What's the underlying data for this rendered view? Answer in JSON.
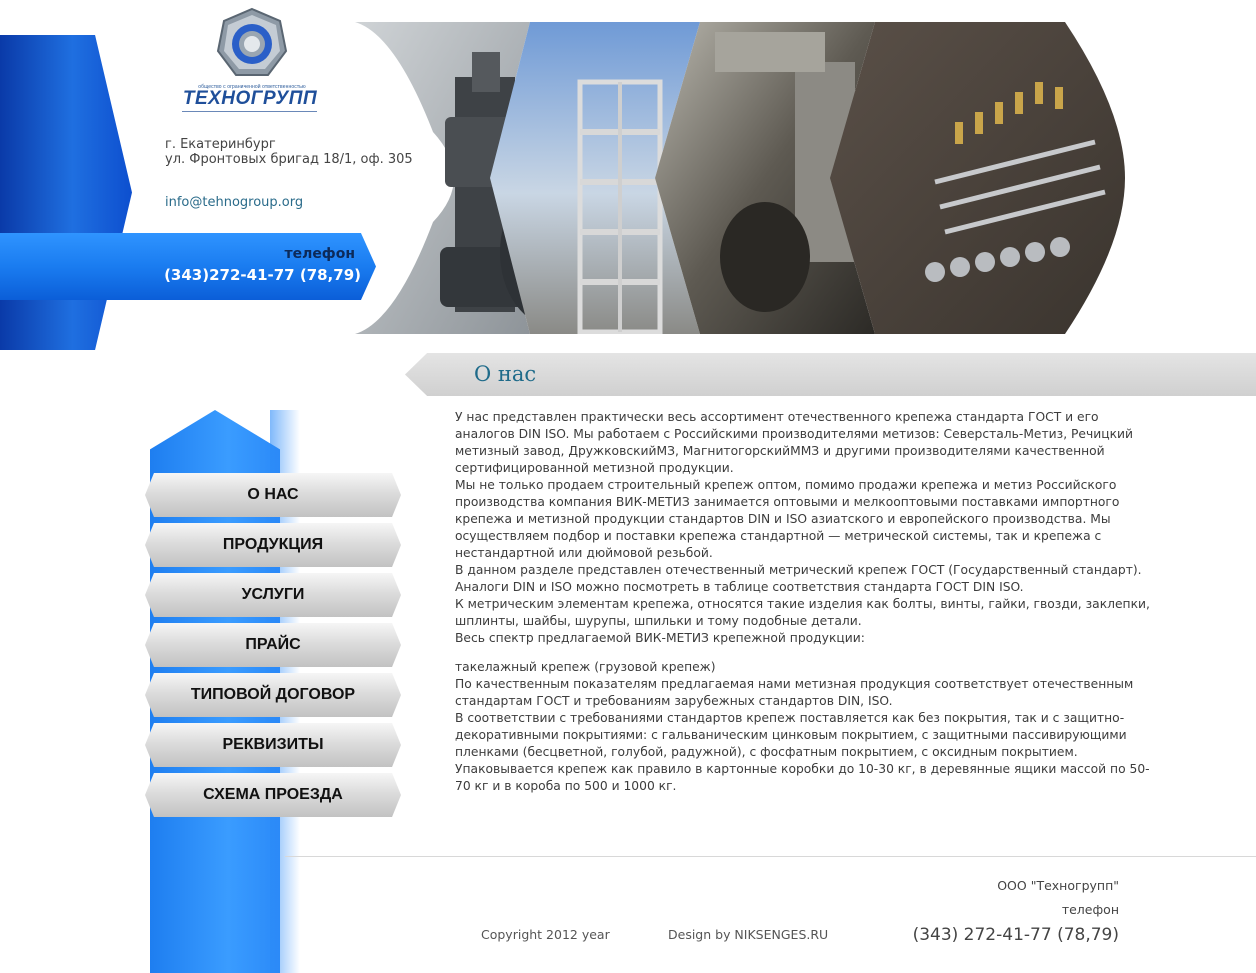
{
  "header": {
    "logo_caption": "общество с ограниченной ответственностью",
    "logo_name": "ТЕХНОГРУПП",
    "address_line1": "г. Екатеринбург",
    "address_line2": "ул. Фронтовых бригад 18/1, оф. 305",
    "email": "info@tehnogroup.org",
    "phone_label": "телефон",
    "phone_number": "(343)272-41-77 (78,79)"
  },
  "banner": {
    "images": [
      "bolts-photo",
      "construction-photo",
      "machinery-photo",
      "fasteners-photo"
    ]
  },
  "main": {
    "title": "О нас",
    "paragraphs": [
      "У нас представлен практически весь ассортимент отечественного крепежа стандарта ГОСТ и его аналогов DIN ISO. Мы работаем с Российскими производителями метизов: Северсталь-Метиз, Речицкий метизный завод, ДружковскийМЗ, МагнитогорскийММЗ и другими производителями качественной сертифицированной метизной продукции.",
      "Мы не только продаем строительный крепеж оптом, помимо продажи крепежа и метиз Российского производства компания ВИК-МЕТИЗ занимается оптовыми и мелкооптовыми поставками импортного крепежа и метизной продукции стандартов DIN и ISO азиатского и европейского производства. Мы осуществляем подбор и поставки крепежа стандартной — метрической системы, так и крепежа с нестандартной или дюймовой резьбой.",
      "В данном разделе представлен отечественный метрический крепеж ГОСТ (Государственный стандарт).",
      "Аналоги DIN и ISO можно посмотреть в таблице соответствия стандарта ГОСТ DIN ISO.",
      "К метрическим элементам  крепежа, относятся такие изделия как болты, винты, гайки, гвозди, заклепки, шплинты, шайбы, шурупы, шпильки и тому подобные детали.",
      "Весь спектр предлагаемой ВИК-МЕТИЗ крепежной продукции:"
    ],
    "paragraphs2": [
      "такелажный крепеж (грузовой крепеж)",
      "По качественным показателям предлагаемая нами метизная продукция соответствует отечественным стандартам ГОСТ и требованиям зарубежных стандартов DIN, ISO.",
      "В соответствии с требованиями стандартов крепеж поставляется как без покрытия, так и с защитно-декоративными покрытиями: с гальваническим цинковым покрытием, с защитными пассивирующими пленками (бесцветной, голубой, радужной), с фосфатным покрытием, с оксидным покрытием.",
      "Упаковывается крепеж как правило в картонные коробки до 10-30 кг, в деревянные ящики массой по 50-70 кг и в короба по 500 и 1000 кг."
    ]
  },
  "menu": {
    "items": [
      {
        "label": "О НАС"
      },
      {
        "label": "ПРОДУКЦИЯ"
      },
      {
        "label": "УСЛУГИ"
      },
      {
        "label": "ПРАЙС"
      },
      {
        "label": "ТИПОВОЙ ДОГОВОР"
      },
      {
        "label": "РЕКВИЗИТЫ"
      },
      {
        "label": "СХЕМА ПРОЕЗДА"
      }
    ]
  },
  "footer": {
    "company": "ООО \"Техногрупп\"",
    "phone_label": "телефон",
    "phone": "(343) 272-41-77 (78,79)",
    "copyright": "Copyright 2012 year",
    "design": "Design by NIKSENGES.RU"
  },
  "colors": {
    "accent_blue": "#1a7cf0",
    "title_teal": "#1f6b8a",
    "menu_gray": "#d0d0d0"
  }
}
